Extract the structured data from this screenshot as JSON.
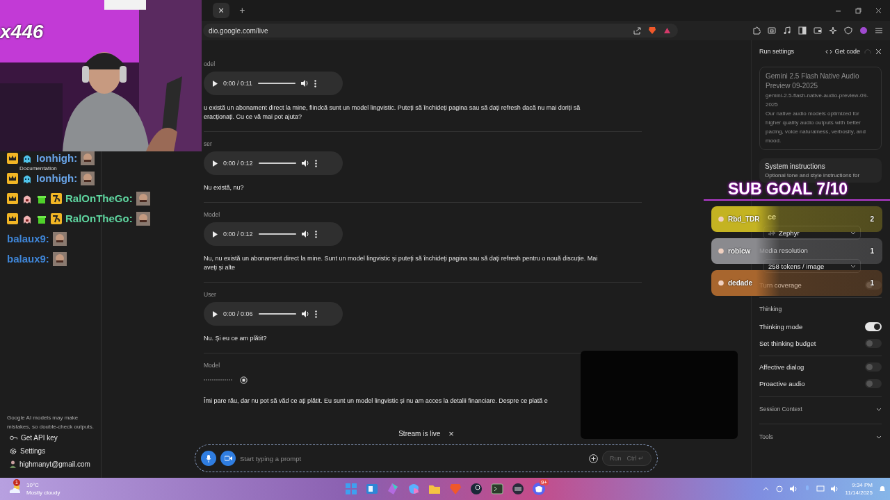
{
  "browser": {
    "tab_close": "×",
    "new_tab": "+",
    "url": "dio.google.com/live"
  },
  "webcam": {
    "counter": "x446"
  },
  "chat": [
    {
      "kind": "ghost",
      "name": "Ionhigh:",
      "color": "#6aa6ea"
    },
    {
      "kind": "ghost",
      "name": "Ionhigh:",
      "color": "#6aa6ea"
    },
    {
      "kind": "gifter",
      "name": "RalOnTheGo:",
      "color": "#5fd6a0"
    },
    {
      "kind": "gifter",
      "name": "RalOnTheGo:",
      "color": "#5fd6a0"
    },
    {
      "kind": "plain",
      "name": "balaux9:",
      "color": "#3f86d8"
    },
    {
      "kind": "plain",
      "name": "balaux9:",
      "color": "#3f86d8"
    }
  ],
  "sidebar": {
    "items": [
      {
        "label": "Documentation"
      }
    ],
    "disclaimer": "Google AI models may make mistakes, so double-check outputs.",
    "links": [
      {
        "kind": "key",
        "label": "Get API key"
      },
      {
        "kind": "gear",
        "label": "Settings"
      },
      {
        "kind": "avatar",
        "label": "highmanyt@gmail.com"
      }
    ]
  },
  "conversation": [
    {
      "role": "odel",
      "kind": "audio",
      "time": "0:00 / 0:11",
      "level": 0,
      "lines": [
        "u există un abonament direct la mine, fiindcă sunt un model lingvistic. Puteți să închideți pagina sau să dați refresh dacă nu mai doriți să",
        "eracționați. Cu ce vă mai pot ajuta?"
      ]
    },
    {
      "role": "ser",
      "kind": "audio",
      "time": "0:00 / 0:12",
      "level": 0,
      "lines": [
        "Nu există, nu?"
      ]
    },
    {
      "role": "Model",
      "kind": "audio",
      "time": "0:00 / 0:12",
      "level": 0,
      "lines": [
        "Nu, nu există un abonament direct la mine. Sunt un model lingvistic și puteți să închideți pagina sau să dați refresh pentru o nouă discuție. Mai",
        "aveți și alte"
      ]
    },
    {
      "role": "User",
      "kind": "audio",
      "time": "0:00 / 0:06",
      "level": 0,
      "lines": [
        "Nu. Și eu ce am plătit?"
      ]
    },
    {
      "role": "Model",
      "kind": "streaming",
      "lines": [
        "Îmi pare rău, dar nu pot să văd ce ați plătit. Eu sunt un model lingvistic și nu am acces la detalii financiare. Despre ce plată e"
      ]
    }
  ],
  "stream_status": {
    "label": "Stream is live",
    "close": "×"
  },
  "prompt": {
    "placeholder": "Start typing a prompt",
    "run": "Run",
    "shortcut": "Ctrl ↵"
  },
  "run_settings": {
    "title": "Run settings",
    "get_code": "Get code",
    "model": {
      "name": "Gemini 2.5 Flash Native Audio Preview 09-2025",
      "id": "gemini-2.5-flash-native-audio-preview-09-2025",
      "description": "Our native audio models optimized for higher quality audio outputs with better pacing, voice naturalness, verbosity, and mood."
    },
    "system_instructions": {
      "title": "System instructions",
      "placeholder": "Optional tone and style instructions for"
    },
    "groups": [
      [
        {
          "kind": "label",
          "label": "ce"
        },
        {
          "kind": "select",
          "label": "Zephyr"
        },
        {
          "kind": "label",
          "label": "Media resolution"
        },
        {
          "kind": "select",
          "label": "258 tokens / image"
        },
        {
          "kind": "toggle",
          "label": "Turn coverage",
          "on": false
        }
      ],
      [
        {
          "kind": "heading",
          "label": "Thinking"
        },
        {
          "kind": "toggle",
          "label": "Thinking mode",
          "on": true
        },
        {
          "kind": "toggle",
          "label": "Set thinking budget",
          "on": false
        }
      ],
      [
        {
          "kind": "toggle",
          "label": "Affective dialog",
          "on": false
        },
        {
          "kind": "toggle",
          "label": "Proactive audio",
          "on": false
        }
      ],
      [
        {
          "kind": "collapsible",
          "label": "Session Context"
        }
      ],
      [
        {
          "kind": "collapsible",
          "label": "Tools"
        }
      ]
    ]
  },
  "sub_goal": "SUB GOAL 7/10",
  "leaderboard": [
    {
      "name": "Rbd_TDR",
      "count": "2",
      "color": "#c4b322"
    },
    {
      "name": "robicw",
      "count": "1",
      "color": "#8a8a8e"
    },
    {
      "name": "dedade",
      "count": "1",
      "color": "#a8662e"
    }
  ],
  "taskbar": {
    "weather": {
      "alerts": "1",
      "temp": "10°C",
      "condition": "Mostly cloudy"
    },
    "apps": [
      {
        "kind": "start"
      },
      {
        "kind": "widgets"
      },
      {
        "kind": "office"
      },
      {
        "kind": "copilot"
      },
      {
        "kind": "folder"
      },
      {
        "kind": "lion"
      },
      {
        "kind": "steam"
      },
      {
        "kind": "terminal"
      },
      {
        "kind": "grid"
      },
      {
        "kind": "discord",
        "badge": "9+"
      }
    ],
    "clock": {
      "time": "9:34 PM",
      "date": "11/14/2025"
    }
  }
}
